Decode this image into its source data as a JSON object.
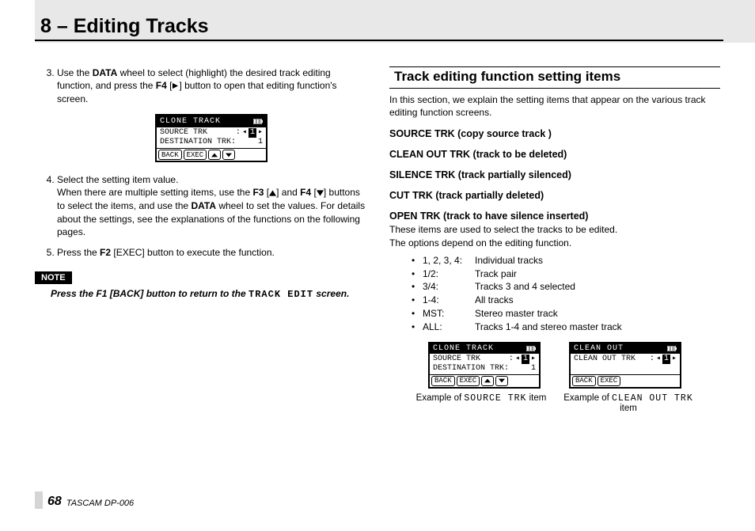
{
  "chapter": "8 – Editing Tracks",
  "steps": {
    "s3a": "Use the ",
    "s3b": "DATA",
    "s3c": " wheel to select (highlight) the desired track editing function, and press the ",
    "s3d": "F4",
    "s3e": " [",
    "s3f": "] button to open that editing function's screen.",
    "s4a": "Select the setting item value.",
    "s4b": "When there are multiple setting items, use the ",
    "s4c": "F3",
    "s4d": " [",
    "s4e": "] and ",
    "s4f": "F4",
    "s4g": " [",
    "s4h": "] buttons to select the items, and use the ",
    "s4i": "DATA",
    "s4j": " wheel to set the values. For details about the settings, see the explanations of the functions on the following pages.",
    "s5a": "Press the ",
    "s5b": "F2",
    "s5c": " [EXEC] button to execute the function."
  },
  "lcd1": {
    "title": "CLONE TRACK",
    "row1k": "SOURCE TRK",
    "row1v": "1",
    "row2k": "DESTINATION TRK:",
    "row2v": "1",
    "b1": "BACK",
    "b2": "EXEC"
  },
  "note": {
    "label": "NOTE",
    "t1": "Press the ",
    "t2": "F1",
    "t3": " [BACK] button to return to the ",
    "t4": "TRACK EDIT",
    "t5": " screen."
  },
  "right": {
    "heading": "Track editing function setting items",
    "intro": "In this section, we explain the setting items that appear on the various track editing function screens.",
    "items": {
      "i1": "SOURCE TRK (copy source track )",
      "i2": "CLEAN OUT TRK (track to be deleted)",
      "i3": "SILENCE TRK (track partially silenced)",
      "i4": "CUT TRK (track partially deleted)",
      "i5": "OPEN TRK (track to have silence inserted)"
    },
    "p1": "These items are used to select the tracks to be edited.",
    "p2": "The options depend on the editing function.",
    "options": [
      {
        "k": "1, 2, 3, 4:",
        "v": "Individual tracks"
      },
      {
        "k": "1/2:",
        "v": "Track pair"
      },
      {
        "k": "3/4:",
        "v": "Tracks 3 and 4 selected"
      },
      {
        "k": "1-4:",
        "v": "All tracks"
      },
      {
        "k": "MST:",
        "v": "Stereo master track"
      },
      {
        "k": "ALL:",
        "v": "Tracks 1-4 and stereo master track"
      }
    ],
    "lcd2": {
      "title": "CLONE TRACK",
      "r1k": "SOURCE TRK",
      "r1v": "1",
      "r2k": "DESTINATION TRK:",
      "r2v": "1",
      "b1": "BACK",
      "b2": "EXEC"
    },
    "lcd3": {
      "title": "CLEAN OUT",
      "r1k": "CLEAN OUT TRK",
      "r1v": "1",
      "b1": "BACK",
      "b2": "EXEC"
    },
    "cap1a": "Example of ",
    "cap1b": "SOURCE TRK",
    "cap1c": " item",
    "cap2a": "Example of ",
    "cap2b": "CLEAN OUT TRK",
    "cap2c": " item"
  },
  "footer": {
    "page": "68",
    "model": "TASCAM  DP-006"
  }
}
